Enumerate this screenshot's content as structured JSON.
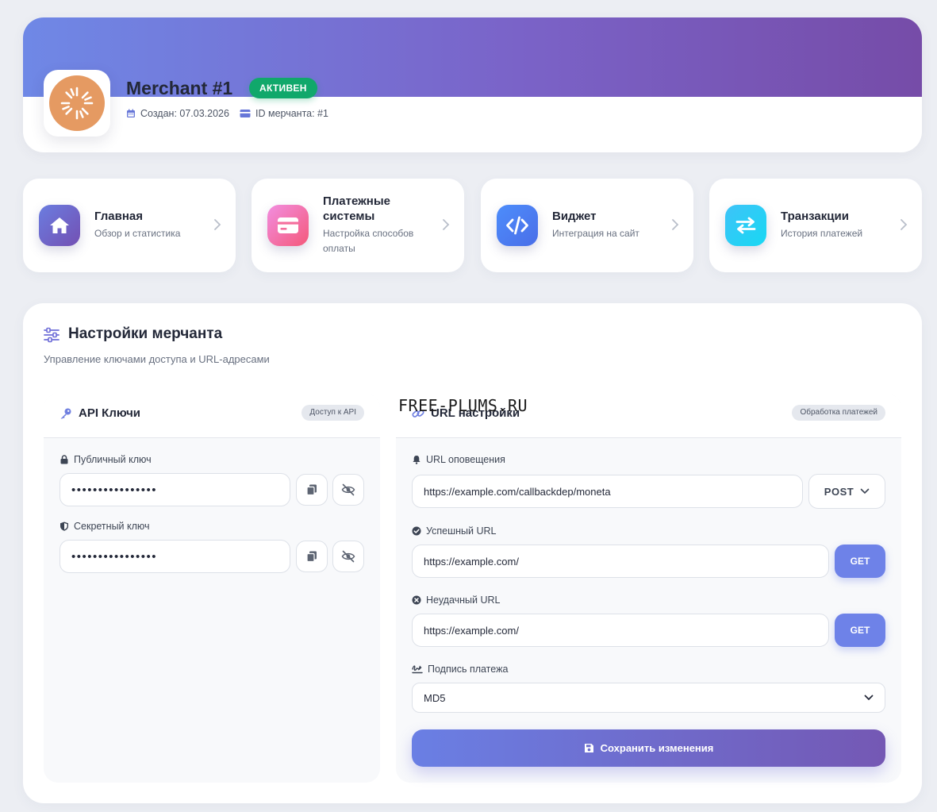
{
  "merchant": {
    "title": "Merchant #1",
    "status": "АКТИВЕН",
    "created": "Создан: 07.03.2026",
    "merchant_id": "ID мерчанта: #1"
  },
  "nav": [
    {
      "title": "Главная",
      "sub": "Обзор и статистика",
      "icon": "home-icon"
    },
    {
      "title_line1": "Платежные",
      "title_line2": "системы",
      "sub_line1": "Настройка способов",
      "sub_line2": "оплаты",
      "icon": "card-icon"
    },
    {
      "title": "Виджет",
      "sub": "Интеграция на сайт",
      "icon": "code-icon"
    },
    {
      "title": "Транзакции",
      "sub": "История платежей",
      "icon": "exchange-icon"
    }
  ],
  "settings": {
    "title": "Настройки мерчанта",
    "subtitle": "Управление ключами доступа и URL-адресами"
  },
  "api_panel": {
    "title": "API Ключи",
    "badge": "Доступ к API",
    "public_label": "Публичный ключ",
    "public_value": "••••••••••••••••",
    "secret_label": "Секретный ключ",
    "secret_value": "••••••••••••••••"
  },
  "url_panel": {
    "title": "URL настройки",
    "badge": "Обработка платежей",
    "notify_label": "URL оповещения",
    "notify_value": "https://example.com/callbackdep/moneta",
    "notify_method": "POST",
    "success_label": "Успешный URL",
    "success_value": "https://example.com/",
    "success_method": "GET",
    "fail_label": "Неудачный URL",
    "fail_value": "https://example.com/",
    "fail_method": "GET",
    "sign_label": "Подпись платежа",
    "sign_value": "MD5",
    "save_label": "Сохранить изменения"
  },
  "watermark": "FREE-PLUMS.RU",
  "colors": {
    "banner_start": "#6f88e6",
    "banner_end": "#764ca8",
    "active_badge": "#10a86b",
    "get_button": "#6e82e8",
    "logo": "#e59a62"
  }
}
